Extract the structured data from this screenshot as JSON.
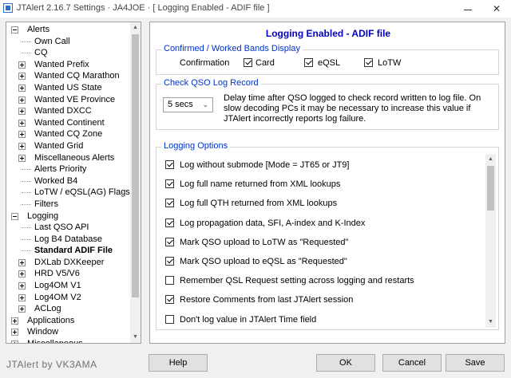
{
  "window": {
    "title": "JTAlert 2.16.7 Settings  ·  JA4JOE  ·  [ Logging Enabled - ADIF file ]",
    "minimize_glyph": "",
    "close_glyph": "✕"
  },
  "tree": {
    "alerts": {
      "label": "Alerts",
      "expanded": true
    },
    "alerts_children": [
      "Own Call",
      "CQ",
      "Wanted Prefix",
      "Wanted CQ Marathon",
      "Wanted US State",
      "Wanted VE Province",
      "Wanted DXCC",
      "Wanted Continent",
      "Wanted CQ Zone",
      "Wanted Grid",
      "Miscellaneous Alerts",
      "Alerts Priority",
      "Worked B4",
      "LoTW / eQSL(AG) Flags",
      "Filters"
    ],
    "alerts_expandable": [
      false,
      false,
      true,
      true,
      true,
      true,
      true,
      true,
      true,
      true,
      true,
      false,
      false,
      false,
      false
    ],
    "logging": {
      "label": "Logging",
      "expanded": true
    },
    "logging_children": [
      "Last QSO API",
      "Log B4 Database",
      "Standard ADIF File",
      "DXLab DXKeeper",
      "HRD V5/V6",
      "Log4OM V1",
      "Log4OM V2",
      "ACLog"
    ],
    "logging_expandable": [
      false,
      false,
      false,
      true,
      true,
      true,
      true,
      true
    ],
    "selected": "Standard ADIF File",
    "applications": "Applications",
    "window_item": "Window",
    "miscellaneous": "Miscellaneous"
  },
  "panel": {
    "heading": "Logging Enabled - ADIF file",
    "confirmed": {
      "legend": "Confirmed / Worked Bands Display",
      "confirmation_label": "Confirmation",
      "card": {
        "label": "Card",
        "checked": true
      },
      "eqsl": {
        "label": "eQSL",
        "checked": true
      },
      "lotw": {
        "label": "LoTW",
        "checked": true
      }
    },
    "check_qso": {
      "legend": "Check QSO Log Record",
      "delay_value": "5 secs",
      "description": "Delay time after QSO logged to check record written to log file. On slow decoding PCs it may be necessary to increase this value if JTAlert incorrectly reports log failure."
    },
    "logging_options": {
      "legend": "Logging Options",
      "options": [
        {
          "label": "Log without submode [Mode = JT65 or JT9]",
          "checked": true
        },
        {
          "label": "Log full name returned from XML lookups",
          "checked": true
        },
        {
          "label": "Log full QTH returned from XML lookups",
          "checked": true
        },
        {
          "label": "Log propagation data, SFI, A-index and K-Index",
          "checked": true
        },
        {
          "label": "Mark QSO upload to LoTW as \"Requested\"",
          "checked": true
        },
        {
          "label": "Mark QSO upload to eQSL as \"Requested\"",
          "checked": true
        },
        {
          "label": "Remember QSL Request setting across logging and restarts",
          "checked": false
        },
        {
          "label": "Restore Comments from last JTAlert session",
          "checked": true
        },
        {
          "label": "Don't log value in JTAlert Time field",
          "checked": false
        }
      ]
    }
  },
  "footer": {
    "brand": "JTAlert by VK3AMA",
    "help": "Help",
    "ok": "OK",
    "cancel": "Cancel",
    "save": "Save"
  }
}
